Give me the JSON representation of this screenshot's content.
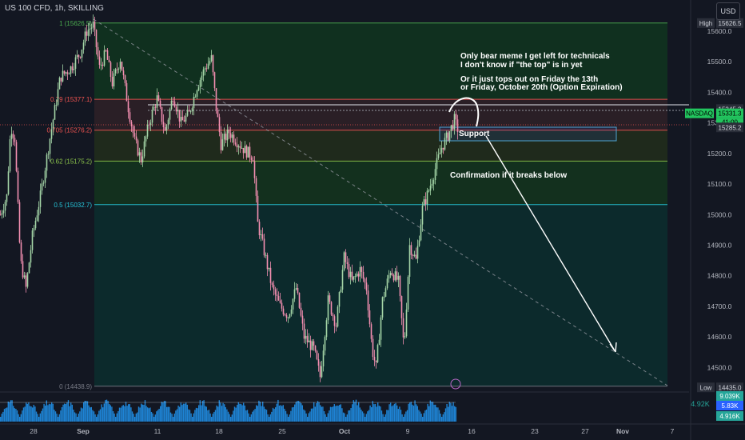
{
  "header": {
    "symbol": "US 100 CFD, 1h, SKILLING",
    "currency": "USD"
  },
  "colors": {
    "background": "#131722",
    "up": "#26a69a",
    "down": "#ef5350",
    "price_up_candle": "#a5d6a7",
    "price_down_candle": "#f48fb1",
    "fib_zone_top": "#0f2e1d",
    "fib_zone_mid": "#15301f",
    "fib_zone_low": "#0b2a2b",
    "nasdaq_tag": "#22c55e",
    "accent": "#2962ff"
  },
  "annotations": {
    "bear_note_l1": "Only bear meme I get left for technicals",
    "bear_note_l2": "I don't know if \"the top\" is in yet",
    "bear_note_l3": "Or it just tops out on Friday the 13th",
    "bear_note_l4": "or Friday, October 20th (Option Expiration)",
    "support": "Support",
    "confirmation": "Confirmation if it breaks below"
  },
  "chart_data": {
    "type": "candlestick",
    "ylim": [
      14420,
      15660
    ],
    "y_ticks": [
      15600.0,
      15500.0,
      15400.0,
      15300.0,
      15200.0,
      15100.0,
      15000.0,
      14900.0,
      14800.0,
      14700.0,
      14600.0,
      14500.0
    ],
    "x_ticks": [
      "28",
      "Sep",
      "11",
      "18",
      "25",
      "Oct",
      "9",
      "16",
      "23",
      "27",
      "Nov",
      "7"
    ],
    "fib_levels": [
      {
        "ratio": "1",
        "price": "15626.5",
        "label": "1 (15626.5)",
        "color": "#4caf50"
      },
      {
        "ratio": "0.79",
        "price": "15377.1",
        "label": "0.79 (15377.1)",
        "color": "#ef5350"
      },
      {
        "ratio": "0.705",
        "price": "15276.2",
        "label": "0.705 (15276.2)",
        "color": "#ef5350"
      },
      {
        "ratio": "0.62",
        "price": "15175.2",
        "label": "0.62 (15175.2)",
        "color": "#8bc34a"
      },
      {
        "ratio": "0.5",
        "price": "15032.7",
        "label": "0.5 (15032.7)",
        "color": "#26c6da"
      },
      {
        "ratio": "0",
        "price": "14438.9",
        "label": "0 (14438.9)",
        "color": "#787b86"
      }
    ],
    "price_tags": [
      {
        "name": "High",
        "price": "15626.5",
        "kind": "high"
      },
      {
        "name": "",
        "price": "15345.2",
        "kind": "plain"
      },
      {
        "name": "NASDAQ",
        "price": "15331.3",
        "kind": "last",
        "countdown": "41:00"
      },
      {
        "name": "",
        "price": "15285.2",
        "kind": "plain"
      },
      {
        "name": "Low",
        "price": "14435.0",
        "kind": "low"
      }
    ],
    "volume_tags": [
      "9.039K",
      "5.83K",
      "4.916K"
    ],
    "volume_left_value": "4.92K",
    "path": [
      [
        0,
        15000
      ],
      [
        8,
        15060
      ],
      [
        13,
        15290
      ],
      [
        18,
        15250
      ],
      [
        25,
        14850
      ],
      [
        32,
        14760
      ],
      [
        40,
        14930
      ],
      [
        50,
        15060
      ],
      [
        62,
        15250
      ],
      [
        75,
        15450
      ],
      [
        88,
        15480
      ],
      [
        100,
        15530
      ],
      [
        108,
        15600
      ],
      [
        116,
        15620
      ],
      [
        124,
        15480
      ],
      [
        132,
        15530
      ],
      [
        140,
        15430
      ],
      [
        150,
        15510
      ],
      [
        160,
        15350
      ],
      [
        168,
        15240
      ],
      [
        176,
        15180
      ],
      [
        186,
        15300
      ],
      [
        196,
        15380
      ],
      [
        206,
        15270
      ],
      [
        216,
        15390
      ],
      [
        226,
        15300
      ],
      [
        236,
        15330
      ],
      [
        246,
        15420
      ],
      [
        256,
        15480
      ],
      [
        264,
        15510
      ],
      [
        270,
        15350
      ],
      [
        276,
        15230
      ],
      [
        286,
        15270
      ],
      [
        296,
        15240
      ],
      [
        306,
        15210
      ],
      [
        316,
        15190
      ],
      [
        322,
        14970
      ],
      [
        330,
        14880
      ],
      [
        340,
        14760
      ],
      [
        350,
        14700
      ],
      [
        360,
        14670
      ],
      [
        370,
        14760
      ],
      [
        380,
        14600
      ],
      [
        392,
        14560
      ],
      [
        400,
        14470
      ],
      [
        410,
        14720
      ],
      [
        420,
        14640
      ],
      [
        430,
        14860
      ],
      [
        440,
        14780
      ],
      [
        450,
        14820
      ],
      [
        458,
        14760
      ],
      [
        465,
        14560
      ],
      [
        470,
        14500
      ],
      [
        478,
        14720
      ],
      [
        488,
        14820
      ],
      [
        498,
        14780
      ],
      [
        505,
        14560
      ],
      [
        512,
        14900
      ],
      [
        520,
        14850
      ],
      [
        528,
        15020
      ],
      [
        536,
        15080
      ],
      [
        544,
        15150
      ],
      [
        552,
        15220
      ],
      [
        560,
        15260
      ],
      [
        568,
        15310
      ],
      [
        572,
        15280
      ]
    ]
  }
}
